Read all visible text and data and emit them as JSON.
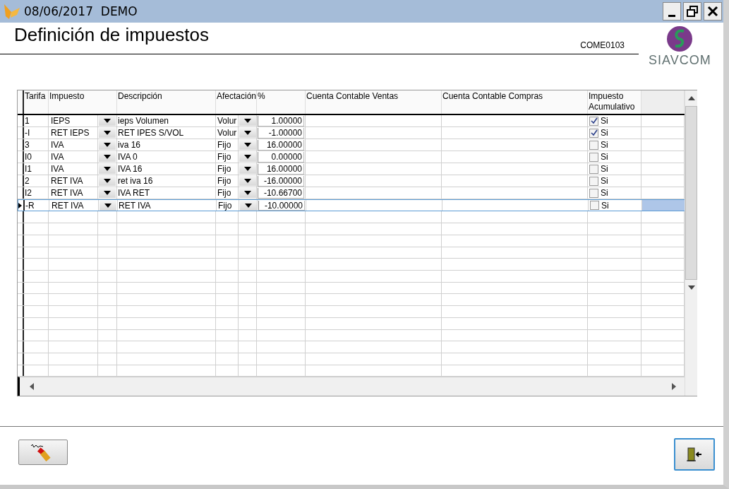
{
  "window": {
    "title": "08/06/2017  DEMO"
  },
  "header": {
    "title": "Definición de impuestos",
    "code": "COME0103",
    "logo_text": "SIAVCOM"
  },
  "table": {
    "columns": [
      "Tarifa",
      "Impuesto",
      "Descripción",
      "Afectación",
      "%",
      "Cuenta Contable Ventas",
      "Cuenta Contable Compras",
      "Impuesto Acumulativo"
    ],
    "rows": [
      {
        "tarifa": "1",
        "impuesto": "IEPS",
        "descripcion": "ieps Volumen",
        "afectacion": "Volur",
        "porcentaje": "1.00000",
        "acumulativo": "Si",
        "checked": true,
        "selected": false
      },
      {
        "tarifa": "-I",
        "impuesto": "RET IEPS",
        "descripcion": "RET IPES S/VOL",
        "afectacion": "Volur",
        "porcentaje": "-1.00000",
        "acumulativo": "Si",
        "checked": true,
        "selected": false
      },
      {
        "tarifa": "3",
        "impuesto": "IVA",
        "descripcion": "iva 16",
        "afectacion": "Fijo",
        "porcentaje": "16.00000",
        "acumulativo": "Si",
        "checked": false,
        "selected": false
      },
      {
        "tarifa": "I0",
        "impuesto": "IVA",
        "descripcion": "IVA 0",
        "afectacion": "Fijo",
        "porcentaje": "0.00000",
        "acumulativo": "Si",
        "checked": false,
        "selected": false
      },
      {
        "tarifa": "I1",
        "impuesto": "IVA",
        "descripcion": "IVA 16",
        "afectacion": "Fijo",
        "porcentaje": "16.00000",
        "acumulativo": "Si",
        "checked": false,
        "selected": false
      },
      {
        "tarifa": "2",
        "impuesto": "RET IVA",
        "descripcion": "ret iva 16",
        "afectacion": "Fijo",
        "porcentaje": "-16.00000",
        "acumulativo": "Si",
        "checked": false,
        "selected": false
      },
      {
        "tarifa": "I2",
        "impuesto": "RET IVA",
        "descripcion": "IVA RET",
        "afectacion": "Fijo",
        "porcentaje": "-10.66700",
        "acumulativo": "Si",
        "checked": false,
        "selected": false
      },
      {
        "tarifa": "-R",
        "impuesto": "RET IVA",
        "descripcion": "RET IVA",
        "afectacion": "Fijo",
        "porcentaje": "-10.00000",
        "acumulativo": "Si",
        "checked": false,
        "selected": true
      }
    ]
  }
}
